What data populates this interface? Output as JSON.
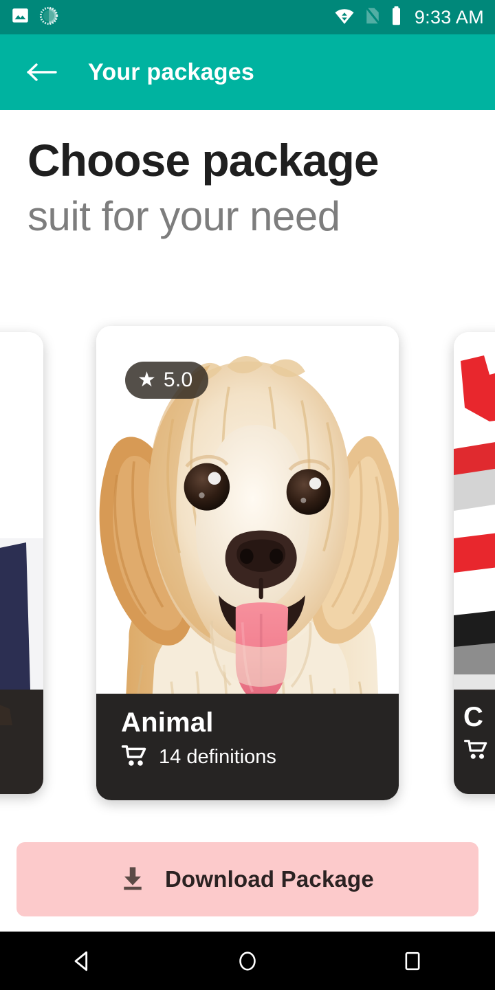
{
  "status_bar": {
    "time": "9:33 AM",
    "icons": {
      "photo": "image-icon",
      "sync": "sync-progress-icon",
      "wifi": "wifi-icon",
      "signal": "no-sim-icon",
      "battery": "battery-icon"
    },
    "background": "#00887a"
  },
  "app_bar": {
    "title": "Your packages",
    "back_icon": "back-arrow-icon",
    "background": "#00b3a0"
  },
  "headings": {
    "title": "Choose package",
    "subtitle": "suit for your need"
  },
  "carousel": {
    "cards": [
      {
        "id": "left-partial",
        "title": "",
        "rating": "",
        "definitions": ""
      },
      {
        "id": "center",
        "title": "Animal",
        "rating": "5.0",
        "star_icon": "star-icon",
        "cart_icon": "shopping-cart-icon",
        "definitions": "14 definitions"
      },
      {
        "id": "right-partial",
        "title": "C",
        "rating": "",
        "cart_icon": "shopping-cart-icon",
        "definitions": ""
      }
    ]
  },
  "download_button": {
    "label": "Download Package",
    "icon": "download-icon",
    "background": "#fccacb",
    "text_color": "#2b2222"
  },
  "nav_bar": {
    "back": "back-triangle-icon",
    "home": "home-circle-icon",
    "recents": "recents-square-icon"
  }
}
